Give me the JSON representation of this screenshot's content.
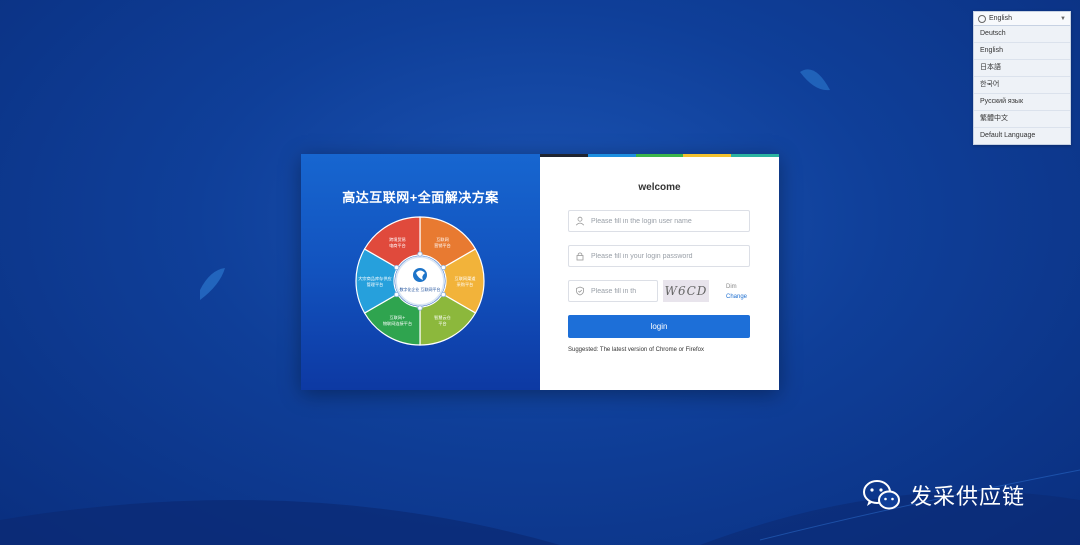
{
  "language_menu": {
    "current": "English",
    "options": [
      "Deutsch",
      "English",
      "日本語",
      "한국어",
      "Русский язык",
      "繁體中文",
      "Default Language"
    ]
  },
  "banner": {
    "title": "高达互联网+全面解决方案",
    "center_label": "数字化企业 互联网平台",
    "segments": [
      {
        "line1": "互联网",
        "line2": "营销平台",
        "color": "#e87a31"
      },
      {
        "line1": "互联网渠道",
        "line2": "采购平台",
        "color": "#f2b33a"
      },
      {
        "line1": "智慧云仓",
        "line2": "平台",
        "color": "#8cb83c"
      },
      {
        "line1": "互联网+",
        "line2": "物联网连接平台",
        "color": "#2fa44f"
      },
      {
        "line1": "大宗商品库存供应",
        "line2": "管理平台",
        "color": "#26a0dc"
      },
      {
        "line1": "跨境贸易",
        "line2": "电商平台",
        "color": "#e04a3c"
      }
    ]
  },
  "login": {
    "welcome": "welcome",
    "username_placeholder": "Please fill in the login user name",
    "password_placeholder": "Please fill in your login password",
    "captcha_placeholder": "Please fill in th",
    "captcha_text": "W6CD",
    "dim_label": "Dim",
    "change_label": "Change",
    "login_button": "login",
    "suggestion": "Suggested: The latest version of Chrome or Firefox",
    "stripe_colors": [
      "#1f2430",
      "#1d8fe0",
      "#3cb54a",
      "#f2c12e",
      "#2bb3a0"
    ]
  },
  "watermark": {
    "text": "发采供应链"
  },
  "colors": {
    "background": "#0f3f99",
    "accent": "#1d6fd8"
  }
}
